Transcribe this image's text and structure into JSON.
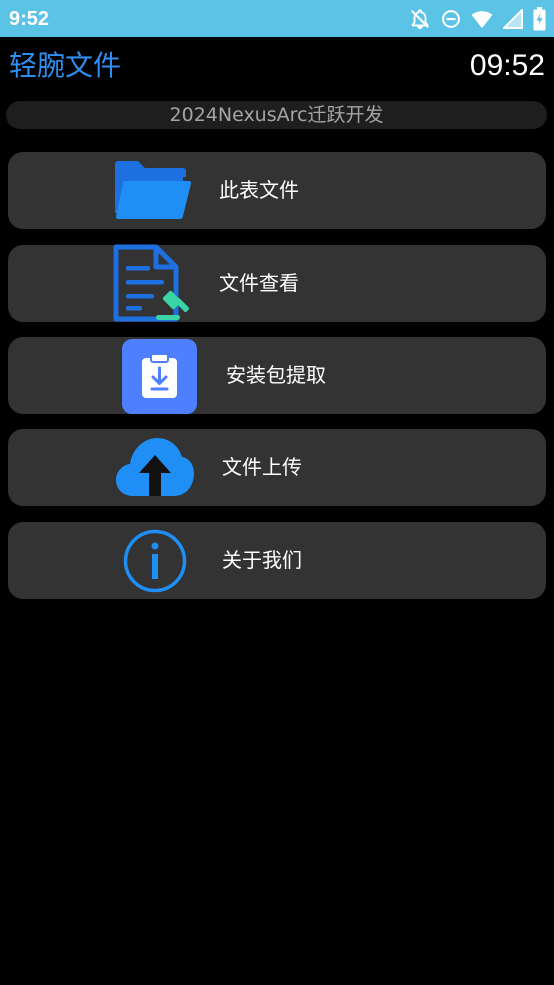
{
  "status_bar": {
    "time": "9:52",
    "icons": [
      "notifications-off-icon",
      "do-not-disturb-icon",
      "wifi-icon",
      "cellular-signal-icon",
      "battery-charging-icon"
    ]
  },
  "header": {
    "app_title": "轻腕文件",
    "clock": "09:52",
    "subtitle": "2024NexusArc迁跃开发"
  },
  "menu": [
    {
      "label": "此表文件",
      "icon": "folder-icon"
    },
    {
      "label": "文件查看",
      "icon": "document-edit-icon"
    },
    {
      "label": "安装包提取",
      "icon": "clipboard-download-icon"
    },
    {
      "label": "文件上传",
      "icon": "cloud-upload-icon"
    },
    {
      "label": "关于我们",
      "icon": "info-icon"
    }
  ],
  "colors": {
    "status_bar": "#5bc3e6",
    "accent": "#2e8ff0",
    "card_bg": "#333333",
    "background": "#000000"
  }
}
